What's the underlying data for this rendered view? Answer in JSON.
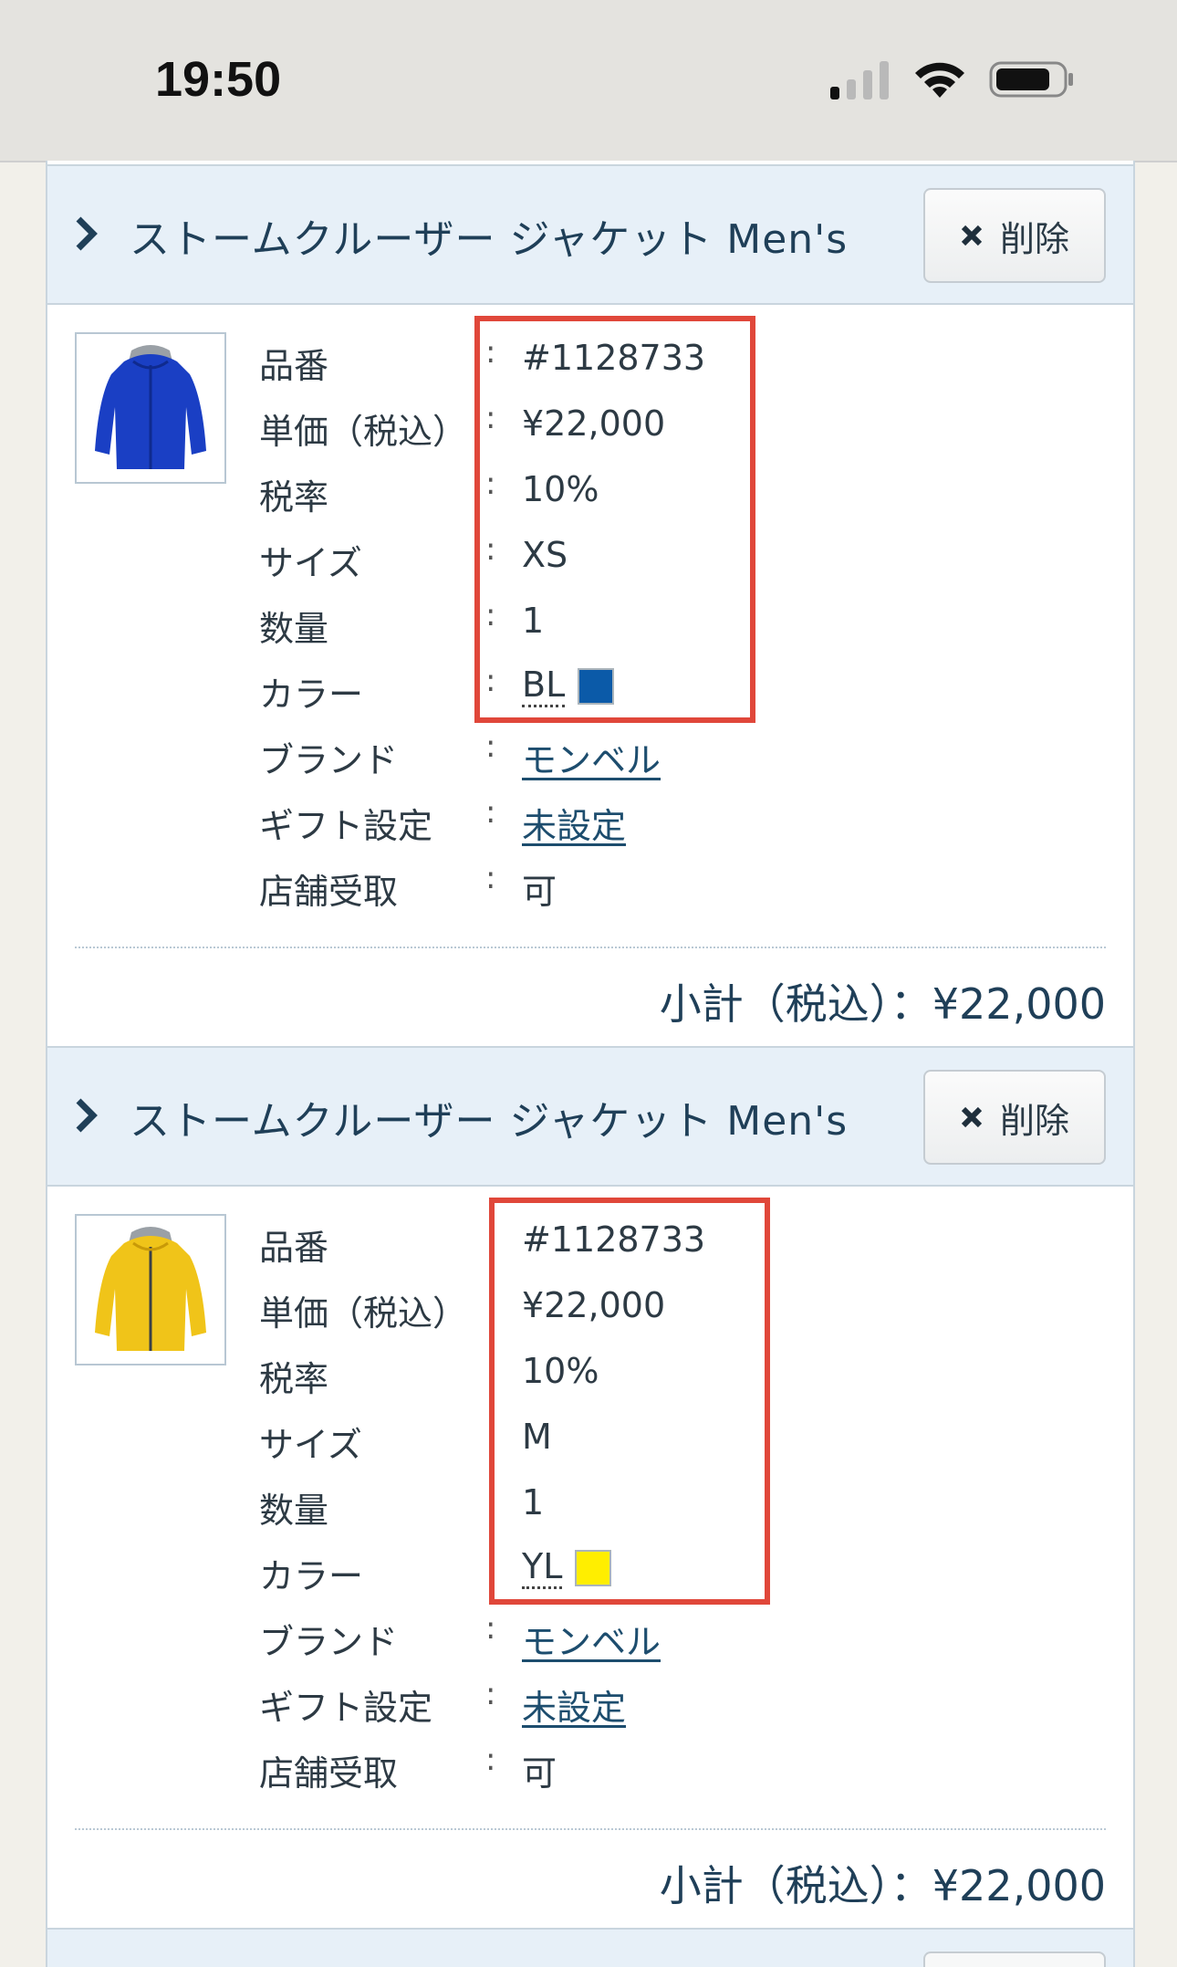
{
  "status_bar": {
    "time": "19:50"
  },
  "items": [
    {
      "title": "ストームクルーザー ジャケット Men's",
      "delete_label": "削除",
      "image": {
        "jacket_color": "#1a3fc4",
        "jacket_dark": "#0f2a8e",
        "hood": "#9aa0a6"
      },
      "details": [
        {
          "label": "品番",
          "value": "#1128733"
        },
        {
          "label": "単価（税込）",
          "value": "¥22,000"
        },
        {
          "label": "税率",
          "value": "10%"
        },
        {
          "label": "サイズ",
          "value": "XS"
        },
        {
          "label": "数量",
          "value": "1"
        },
        {
          "label": "カラー",
          "value": "BL",
          "swatch": "#0b5aa8"
        },
        {
          "label": "ブランド",
          "value": "モンベル"
        },
        {
          "label": "ギフト設定",
          "value": "未設定"
        },
        {
          "label": "店舗受取",
          "value": "可"
        }
      ],
      "subtotal": "小計（税込）：¥22,000"
    },
    {
      "title": "ストームクルーザー ジャケット Men's",
      "delete_label": "削除",
      "image": {
        "jacket_color": "#f0c419",
        "jacket_dark": "#c99a08",
        "hood": "#9aa0a6"
      },
      "details": [
        {
          "label": "品番",
          "value": "#1128733"
        },
        {
          "label": "単価（税込）",
          "value": "¥22,000"
        },
        {
          "label": "税率",
          "value": "10%"
        },
        {
          "label": "サイズ",
          "value": "M"
        },
        {
          "label": "数量",
          "value": "1"
        },
        {
          "label": "カラー",
          "value": "YL",
          "swatch": "#ffee00"
        },
        {
          "label": "ブランド",
          "value": "モンベル"
        },
        {
          "label": "ギフト設定",
          "value": "未設定"
        },
        {
          "label": "店舗受取",
          "value": "可"
        }
      ],
      "subtotal": "小計（税込）：¥22,000"
    }
  ],
  "colors": {
    "highlight": "#e0473a",
    "header_bg": "#e7f0f8",
    "title": "#1f3f58"
  }
}
